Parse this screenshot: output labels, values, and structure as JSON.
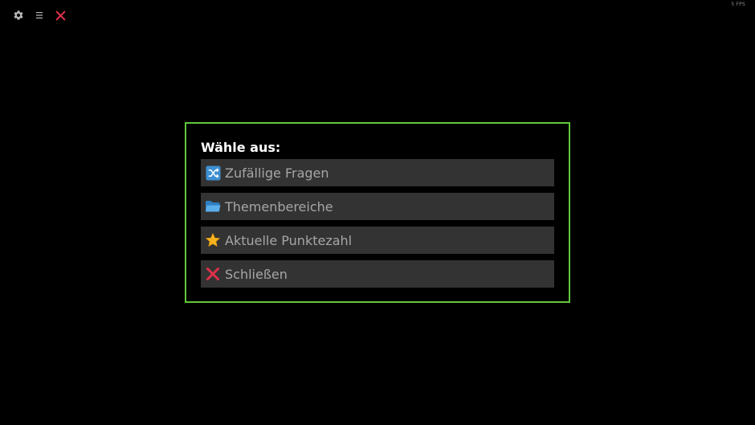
{
  "fps": "5 FPS",
  "toolbar": {
    "buttons": [
      {
        "icon": "gear-icon"
      },
      {
        "icon": "hamburger-menu-icon"
      },
      {
        "icon": "close-icon",
        "color": "#e0304a"
      }
    ]
  },
  "dialog": {
    "title": "Wähle aus:",
    "border_color": "#62c73a",
    "items": [
      {
        "label": "Zufällige Fragen",
        "icon": "shuffle-icon"
      },
      {
        "label": "Themenbereiche",
        "icon": "folder-icon"
      },
      {
        "label": "Aktuelle Punktezahl",
        "icon": "star-icon"
      },
      {
        "label": "Schließen",
        "icon": "cross-icon"
      }
    ]
  },
  "colors": {
    "background": "#000000",
    "item_background": "#333333",
    "item_text": "#a6a6a6",
    "title_text": "#ffffff"
  }
}
